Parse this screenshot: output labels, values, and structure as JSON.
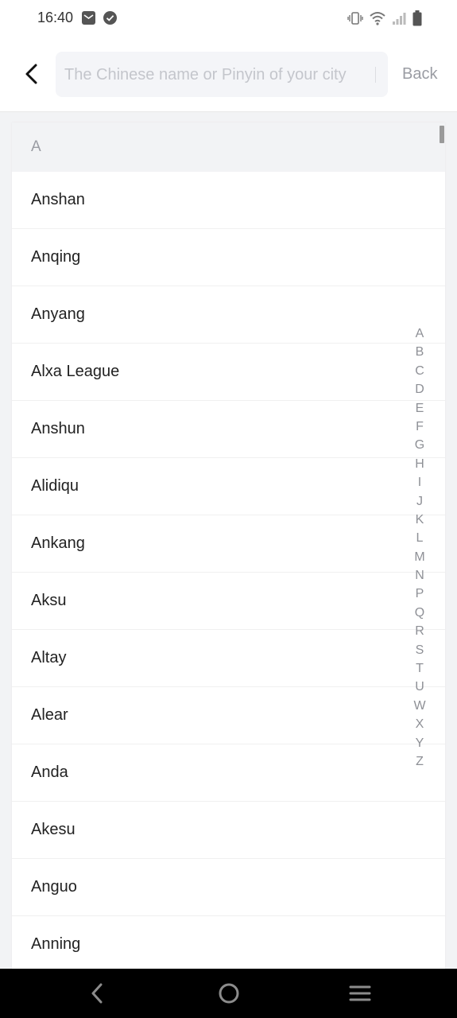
{
  "status_bar": {
    "time": "16:40",
    "left_icons": [
      "mail-icon",
      "check-circle-icon"
    ],
    "right_icons": [
      "vibrate-icon",
      "wifi-icon",
      "signal-icon",
      "battery-icon"
    ]
  },
  "header": {
    "search_placeholder": "The Chinese name or Pinyin of your city",
    "back_label": "Back"
  },
  "city_list": {
    "section_letter": "A",
    "items": [
      "Anshan",
      "Anqing",
      "Anyang",
      "Alxa League",
      "Anshun",
      "Alidiqu",
      "Ankang",
      "Aksu",
      "Altay",
      "Alear",
      "Anda",
      "Akesu",
      "Anguo",
      "Anning"
    ]
  },
  "alpha_index": [
    "A",
    "B",
    "C",
    "D",
    "E",
    "F",
    "G",
    "H",
    "I",
    "J",
    "K",
    "L",
    "M",
    "N",
    "P",
    "Q",
    "R",
    "S",
    "T",
    "U",
    "W",
    "X",
    "Y",
    "Z"
  ],
  "nav_bar": [
    "back-nav-icon",
    "home-nav-icon",
    "menu-nav-icon"
  ]
}
